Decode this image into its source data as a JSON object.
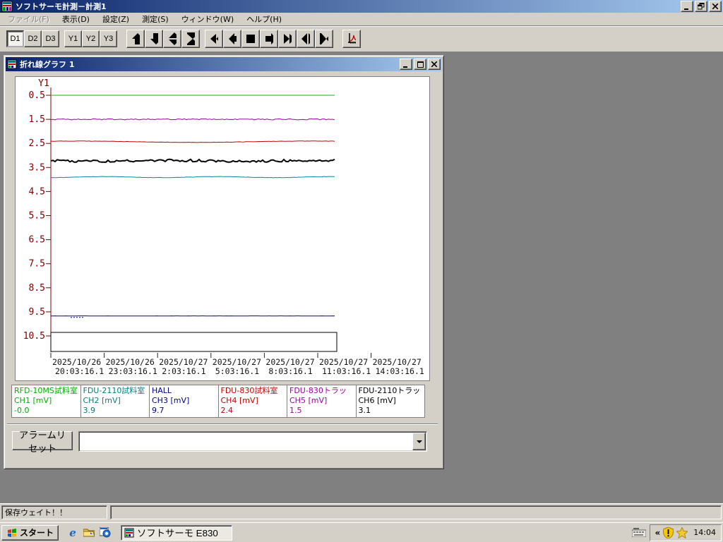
{
  "window": {
    "title": "ソフトサーモ計測－計測1"
  },
  "menu": {
    "items": [
      {
        "label": "ファイル(F)",
        "enabled": false
      },
      {
        "label": "表示(D)",
        "enabled": true
      },
      {
        "label": "設定(Z)",
        "enabled": true
      },
      {
        "label": "測定(S)",
        "enabled": true
      },
      {
        "label": "ウィンドウ(W)",
        "enabled": true
      },
      {
        "label": "ヘルプ(H)",
        "enabled": true
      }
    ]
  },
  "toolbar": {
    "d_buttons": [
      "D1",
      "D2",
      "D3"
    ],
    "active_button": "D1",
    "y_buttons": [
      "Y1",
      "Y2",
      "Y3"
    ],
    "icon_buttons": [
      "up-arrow",
      "down-arrow",
      "expand-vertical",
      "compress-vertical",
      "fast-rewind",
      "step-back",
      "stop",
      "step-forward",
      "fast-forward",
      "expand-horizontal",
      "compress-horizontal",
      "graph-tool"
    ]
  },
  "graph_window": {
    "title": "折れ線グラフ 1"
  },
  "chart_data": {
    "type": "line",
    "axis_label": "Y1",
    "axis_color": "#800000",
    "y_inverted": true,
    "y_min": 0.5,
    "y_max": 10.5,
    "y_ticks": [
      "0.5",
      "1.5",
      "2.5",
      "3.5",
      "4.5",
      "5.5",
      "6.5",
      "7.5",
      "8.5",
      "9.5",
      "10.5"
    ],
    "x_ticks": [
      {
        "date": "2025/10/26",
        "time": "20:03:16.1"
      },
      {
        "date": "2025/10/26",
        "time": "23:03:16.1"
      },
      {
        "date": "2025/10/27",
        "time": "2:03:16.1"
      },
      {
        "date": "2025/10/27",
        "time": "5:03:16.1"
      },
      {
        "date": "2025/10/27",
        "time": "8:03:16.1"
      },
      {
        "date": "2025/10/27",
        "time": "11:03:16.1"
      },
      {
        "date": "2025/10/27",
        "time": "14:03:16.1"
      }
    ],
    "series": [
      {
        "name": "CH1",
        "color": "#00c000",
        "width": 1,
        "value": -0.0,
        "plot_value": 0.5,
        "noise": 0,
        "wave_amp": 0,
        "wave_len": 1
      },
      {
        "name": "CH5",
        "color": "#9400a0",
        "width": 1,
        "value": 1.5,
        "plot_value": 1.5,
        "noise": 0.8,
        "wave_amp": 0,
        "wave_len": 1
      },
      {
        "name": "CH4",
        "color": "#c00000",
        "width": 1,
        "value": 2.4,
        "plot_value": 2.43,
        "noise": 0.2,
        "wave_amp": 0.9,
        "wave_len": 330
      },
      {
        "name": "CH6",
        "color": "#000000",
        "width": 2,
        "value": 3.1,
        "plot_value": 3.22,
        "noise": 1.7,
        "wave_amp": 0.6,
        "wave_len": 210
      },
      {
        "name": "CH2",
        "color": "#0089a0",
        "width": 1,
        "value": 3.9,
        "plot_value": 3.9,
        "noise": 0.25,
        "wave_amp": 0.7,
        "wave_len": 160
      },
      {
        "name": "CH3",
        "color": "#0000a0",
        "width": 1,
        "value": 9.7,
        "plot_value": 9.67,
        "noise": 0.1,
        "wave_amp": 0,
        "wave_len": 1,
        "dip": true
      }
    ]
  },
  "legend": {
    "channels": [
      {
        "name": "RFD-10MS試料室",
        "ch": "CH1 [mV]",
        "value": "-0.0",
        "color": "#00b000"
      },
      {
        "name": "FDU-2110試料室",
        "ch": "CH2 [mV]",
        "value": "3.9",
        "color": "#008080"
      },
      {
        "name": "HALL",
        "ch": "CH3 [mV]",
        "value": "9.7",
        "color": "#000080"
      },
      {
        "name": "FDU-830試料室",
        "ch": "CH4 [mV]",
        "value": "2.4",
        "color": "#c00000"
      },
      {
        "name": "FDU-830トラッ",
        "ch": "CH5 [mV]",
        "value": "1.5",
        "color": "#a000a0"
      },
      {
        "name": "FDU-2110トラッ",
        "ch": "CH6 [mV]",
        "value": "3.1",
        "color": "#000000"
      }
    ]
  },
  "alarm": {
    "reset_label": "アラームリセット",
    "combo_value": ""
  },
  "statusbar": {
    "message": "保存ウェイト！！"
  },
  "taskbar": {
    "start_label": "スタート",
    "quicklaunch": [
      {
        "icon": "ie-icon",
        "glyph": "e"
      },
      {
        "icon": "folder-icon",
        "glyph": ""
      },
      {
        "icon": "ie-page-icon",
        "glyph": "e"
      }
    ],
    "task_label": "ソフトサーモ E830",
    "tray_chevron": "«",
    "clock": "14:04"
  }
}
